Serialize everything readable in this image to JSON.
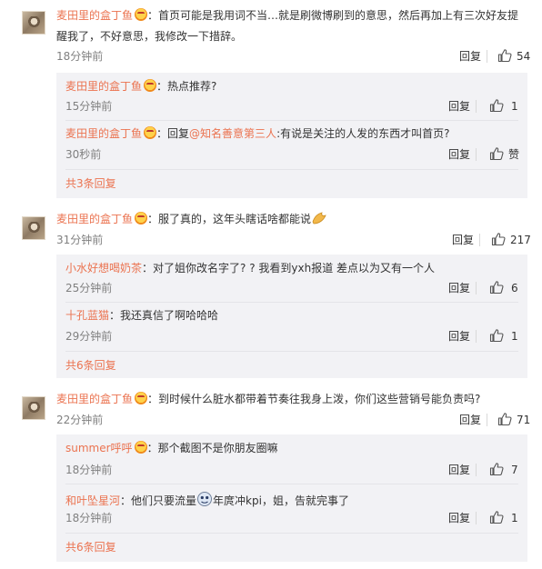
{
  "threads": [
    {
      "author": "麦田里的盒丁鱼",
      "text_line1": "首页可能是我用词不当…就是刷微博刷到的意思，然后再加上有三次好友提",
      "text_line2": "醒我了，不好意思，我修改一下措辞。",
      "time": "18分钟前",
      "reply_label": "回复",
      "likes": "54",
      "replies": [
        {
          "author": "麦田里的盒丁鱼",
          "text": "热点推荐?",
          "time": "15分钟前",
          "reply_label": "回复",
          "likes": "1"
        },
        {
          "author": "麦田里的盒丁鱼",
          "prefix": "回复",
          "mention": "@知名善意第三人",
          "text": "有说是关注的人发的东西才叫首页?",
          "time": "30秒前",
          "reply_label": "回复",
          "likes": "赞"
        }
      ],
      "more": "共3条回复"
    },
    {
      "author": "麦田里的盒丁鱼",
      "text_line1": "服了真的，这年头瞎话啥都能说",
      "time": "31分钟前",
      "reply_label": "回复",
      "likes": "217",
      "replies": [
        {
          "author": "小水好想喝奶茶",
          "text": "对了姐你改名字了? ? 我看到yxh报道 差点以为又有一个人",
          "time": "25分钟前",
          "reply_label": "回复",
          "likes": "6"
        },
        {
          "author": "十孔蓝猫",
          "text": "我还真信了啊哈哈哈",
          "time": "29分钟前",
          "reply_label": "回复",
          "likes": "1"
        }
      ],
      "more": "共6条回复"
    },
    {
      "author": "麦田里的盒丁鱼",
      "text_line1": "到时候什么脏水都带着节奏往我身上泼，你们这些营销号能负责吗?",
      "time": "22分钟前",
      "reply_label": "回复",
      "likes": "71",
      "replies": [
        {
          "author": "summer呼呼",
          "text": "那个截图不是你朋友圈嘛",
          "time": "18分钟前",
          "reply_label": "回复",
          "likes": "7"
        },
        {
          "author": "和叶坠星河",
          "text_a": "他们只要流量",
          "text_b": "年庹冲kpi，姐，告就完事了",
          "time": "18分钟前",
          "reply_label": "回复",
          "likes": "1"
        }
      ],
      "more": "共6条回复"
    }
  ],
  "colors": {
    "name": "#eb7350",
    "time": "#808080",
    "subbox_bg": "#f2f2f5",
    "separator": "#e5e5e5"
  }
}
